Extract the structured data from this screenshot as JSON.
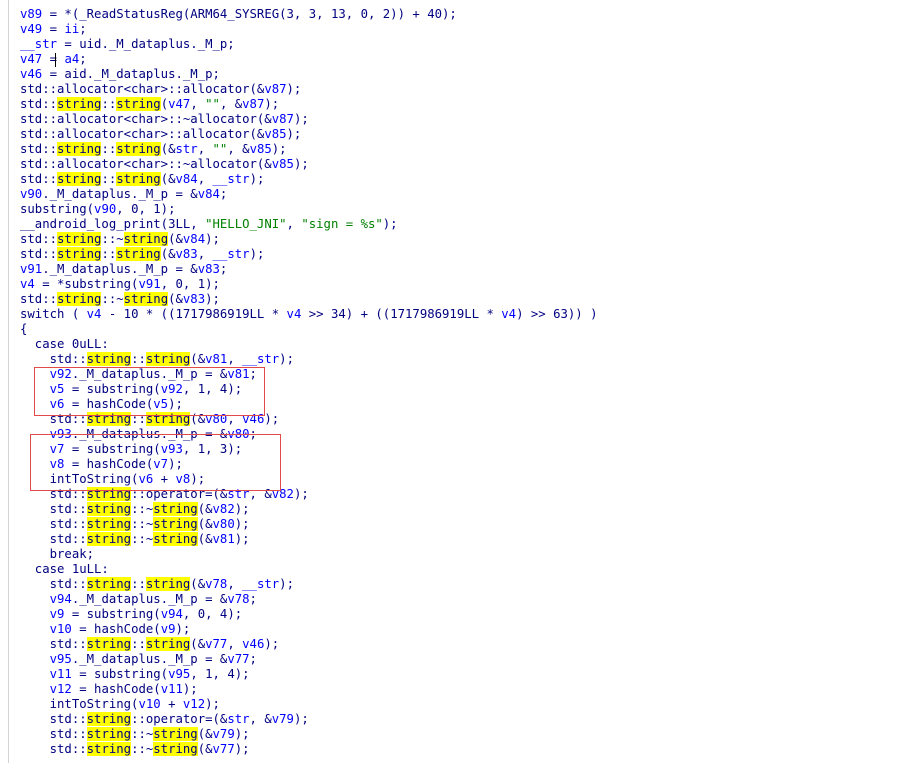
{
  "code": {
    "lines": [
      "v89 = *(_ReadStatusReg(ARM64_SYSREG(3, 3, 13, 0, 2)) + 40);",
      "v49 = ii;",
      "__str = uid._M_dataplus._M_p;",
      "v47 = a4;",
      "v46 = aid._M_dataplus._M_p;",
      "std::allocator<char>::allocator(&v87);",
      "std::string::string(v47, \"\", &v87);",
      "std::allocator<char>::~allocator(&v87);",
      "std::allocator<char>::allocator(&v85);",
      "std::string::string(&str, \"\", &v85);",
      "std::allocator<char>::~allocator(&v85);",
      "std::string::string(&v84, __str);",
      "v90._M_dataplus._M_p = &v84;",
      "substring(v90, 0, 1);",
      "__android_log_print(3LL, \"HELLO_JNI\", \"sign = %s\");",
      "std::string::~string(&v84);",
      "std::string::string(&v83, __str);",
      "v91._M_dataplus._M_p = &v83;",
      "v4 = *substring(v91, 0, 1);",
      "std::string::~string(&v83);",
      "switch ( v4 - 10 * ((1717986919LL * v4 >> 34) + ((1717986919LL * v4) >> 63)) )",
      "{",
      "  case 0uLL:",
      "    std::string::string(&v81, __str);",
      "    v92._M_dataplus._M_p = &v81;",
      "    v5 = substring(v92, 1, 4);",
      "    v6 = hashCode(v5);",
      "    std::string::string(&v80, v46);",
      "    v93._M_dataplus._M_p = &v80;",
      "    v7 = substring(v93, 1, 3);",
      "    v8 = hashCode(v7);",
      "    intToString(v6 + v8);",
      "    std::string::operator=(&str, &v82);",
      "    std::string::~string(&v82);",
      "    std::string::~string(&v80);",
      "    std::string::~string(&v81);",
      "    break;",
      "  case 1uLL:",
      "    std::string::string(&v78, __str);",
      "    v94._M_dataplus._M_p = &v78;",
      "    v9 = substring(v94, 0, 4);",
      "    v10 = hashCode(v9);",
      "    std::string::string(&v77, v46);",
      "    v95._M_dataplus._M_p = &v77;",
      "    v11 = substring(v95, 1, 4);",
      "    v12 = hashCode(v11);",
      "    intToString(v10 + v12);",
      "    std::string::operator=(&str, &v79);",
      "    std::string::~string(&v79);",
      "    std::string::~string(&v77);"
    ],
    "highlight_word": "string",
    "colors": {
      "text": "#000080",
      "variable": "#0000ff",
      "string_literal": "#008000",
      "highlight": "#ffff00",
      "annotation_box": "#e24a4a"
    }
  }
}
